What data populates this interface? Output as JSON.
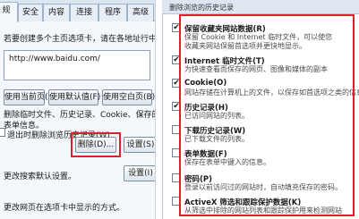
{
  "internet_options": {
    "tabs": [
      "规",
      "安全",
      "内容",
      "连接",
      "程序",
      "高级"
    ],
    "homepage_description": "若要创建多个主页选项卡，请在各地址行中键入地址(R)。",
    "homepage_url": "http://www.baidu.com/",
    "buttons": {
      "use_current": "使用当前页(C)",
      "use_default": "使用默认值(F)",
      "use_blank": "使用空白页(B)"
    },
    "history": {
      "line1": "删除临时文件、历史记录、Cookie、保存的密码和网页",
      "line2": "表单信息。",
      "exit_delete": "退出时删除浏览历史记录(W)",
      "delete_button": "删除(D)...",
      "settings_button": "设置(S)"
    },
    "search": {
      "line": "更改搜索默认设置。",
      "settings_button": "设置(I)"
    },
    "tabs_section": {
      "line": "更改网页在选项卡中显示的方式。"
    }
  },
  "delete_history": {
    "title": "删除浏览的历史记录",
    "options": [
      {
        "checked": true,
        "title": "保留收藏夹网站数据(R)",
        "desc": [
          "保留 Cookie 和 Internet 临时文件，可以使您",
          "收藏夹网站保留首选项并更快地显示。"
        ]
      },
      {
        "checked": true,
        "title": "Internet 临时文件(T)",
        "desc": [
          "为快速查看而保存的网页、图像和媒体的副本"
        ]
      },
      {
        "checked": true,
        "title": "Cookie(O)",
        "desc": [
          "网站存储在计算机上的文件，以保存如首选项之类的信息"
        ]
      },
      {
        "checked": true,
        "title": "历史记录(H)",
        "desc": [
          "已访问网站的列表。"
        ]
      },
      {
        "checked": false,
        "title": "下载历史记录(W)",
        "desc": [
          "已下载文件的列表。"
        ]
      },
      {
        "checked": false,
        "title": "表单数据(F)",
        "desc": [
          "保存在表单中键入的信息。"
        ]
      },
      {
        "checked": false,
        "title": "密码(P)",
        "desc": [
          "登录以前访问过的网站时，自动填充保存的密码。"
        ]
      },
      {
        "checked": false,
        "title": "ActiveX 筛选和跟踪保护数据(K)",
        "desc": [
          "从筛选中排除的网站列表和跟踪保护用来检测网站"
        ]
      }
    ]
  },
  "colors": {
    "highlight": "#d8232a"
  }
}
